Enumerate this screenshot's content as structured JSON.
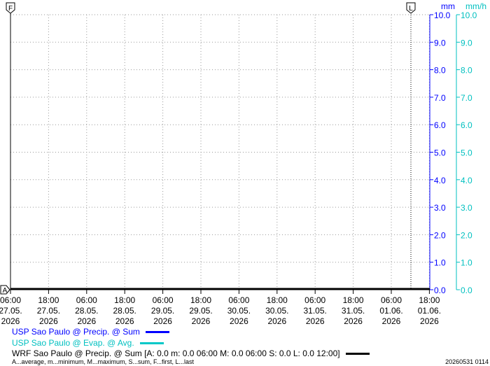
{
  "chart_data": {
    "type": "line",
    "x_ticks": [
      {
        "time": "06:00",
        "date": "27.05.",
        "year": "2026"
      },
      {
        "time": "18:00",
        "date": "27.05.",
        "year": "2026"
      },
      {
        "time": "06:00",
        "date": "28.05.",
        "year": "2026"
      },
      {
        "time": "18:00",
        "date": "28.05.",
        "year": "2026"
      },
      {
        "time": "06:00",
        "date": "29.05.",
        "year": "2026"
      },
      {
        "time": "18:00",
        "date": "29.05.",
        "year": "2026"
      },
      {
        "time": "06:00",
        "date": "30.05.",
        "year": "2026"
      },
      {
        "time": "18:00",
        "date": "30.05.",
        "year": "2026"
      },
      {
        "time": "06:00",
        "date": "31.05.",
        "year": "2026"
      },
      {
        "time": "18:00",
        "date": "31.05.",
        "year": "2026"
      },
      {
        "time": "06:00",
        "date": "01.06.",
        "year": "2026"
      },
      {
        "time": "18:00",
        "date": "01.06.",
        "year": "2026"
      }
    ],
    "y_axes": [
      {
        "unit": "mm",
        "color": "#0000ff",
        "ylim": [
          0,
          10
        ],
        "ticks": [
          "0.0",
          "1.0",
          "2.0",
          "3.0",
          "4.0",
          "5.0",
          "6.0",
          "7.0",
          "8.0",
          "9.0",
          "10.0"
        ]
      },
      {
        "unit": "mm/h",
        "color": "#00c0c0",
        "ylim": [
          0,
          10
        ],
        "ticks": [
          "0.0",
          "1.0",
          "2.0",
          "3.0",
          "4.0",
          "5.0",
          "6.0",
          "7.0",
          "8.0",
          "9.0",
          "10.0"
        ]
      }
    ],
    "grid": true,
    "markers": {
      "first": "F",
      "last": "L",
      "average": "A"
    },
    "series": [
      {
        "name": "USP Sao Paulo @ Precip. @ Sum",
        "color": "#0000ff",
        "values": []
      },
      {
        "name": "USP Sao Paulo @ Evap. @ Avg.",
        "color": "#00c0c0",
        "values": []
      },
      {
        "name": "WRF Sao Paulo @ Precip. @ Sum",
        "color": "#000000",
        "values": [
          0,
          0,
          0,
          0,
          0,
          0,
          0,
          0,
          0,
          0,
          0,
          0
        ]
      }
    ]
  },
  "legend": {
    "item1": "USP Sao Paulo @ Precip. @ Sum",
    "item2": "USP Sao Paulo @ Evap. @ Avg.",
    "item3": "WRF Sao Paulo @ Precip. @ Sum [A: 0.0 m: 0.0 06:00 M: 0.0 06:00 S: 0.0 L: 0.0 12:00]"
  },
  "footnote": "A...average, m...minimum, M...maximum, S...sum, F...first, L...last",
  "timestamp": "20260531 0114"
}
